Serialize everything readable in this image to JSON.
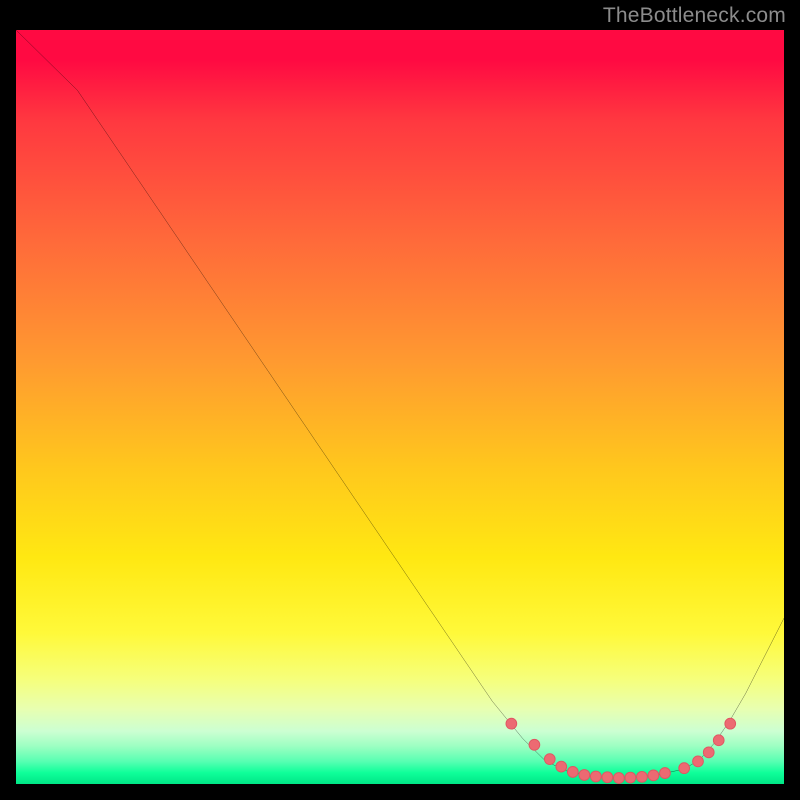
{
  "watermark": "TheBottleneck.com",
  "colors": {
    "jsonbackground": "#000000",
    "curve": "#000000",
    "marker_fill": "#ec6a72",
    "marker_stroke": "#e05562",
    "gradient_top": "#ff0a42",
    "gradient_bottom": "#00e686"
  },
  "chart_data": {
    "type": "line",
    "title": "",
    "xlabel": "",
    "ylabel": "",
    "x_range": [
      0,
      100
    ],
    "y_range": [
      0,
      100
    ],
    "series": [
      {
        "name": "curve",
        "x": [
          0,
          8,
          16,
          24,
          32,
          40,
          48,
          56,
          62,
          66,
          69,
          72,
          75,
          78,
          81,
          84,
          87,
          89,
          91,
          93,
          95,
          97,
          100
        ],
        "y": [
          100,
          92,
          80,
          68,
          56,
          44,
          32,
          20,
          11,
          6,
          3,
          1.6,
          1.0,
          0.8,
          0.9,
          1.3,
          2.0,
          3.2,
          5.5,
          8.5,
          12,
          16,
          22
        ]
      }
    ],
    "markers": {
      "name": "highlight-dots",
      "x": [
        64.5,
        67.5,
        69.5,
        71.0,
        72.5,
        74.0,
        75.5,
        77.0,
        78.5,
        80.0,
        81.5,
        83.0,
        84.5,
        87.0,
        88.8,
        90.2,
        91.5,
        93.0
      ],
      "y": [
        8.0,
        5.2,
        3.3,
        2.3,
        1.6,
        1.2,
        1.0,
        0.9,
        0.8,
        0.85,
        0.95,
        1.15,
        1.45,
        2.1,
        3.0,
        4.2,
        5.8,
        8.0
      ]
    },
    "annotations": []
  }
}
